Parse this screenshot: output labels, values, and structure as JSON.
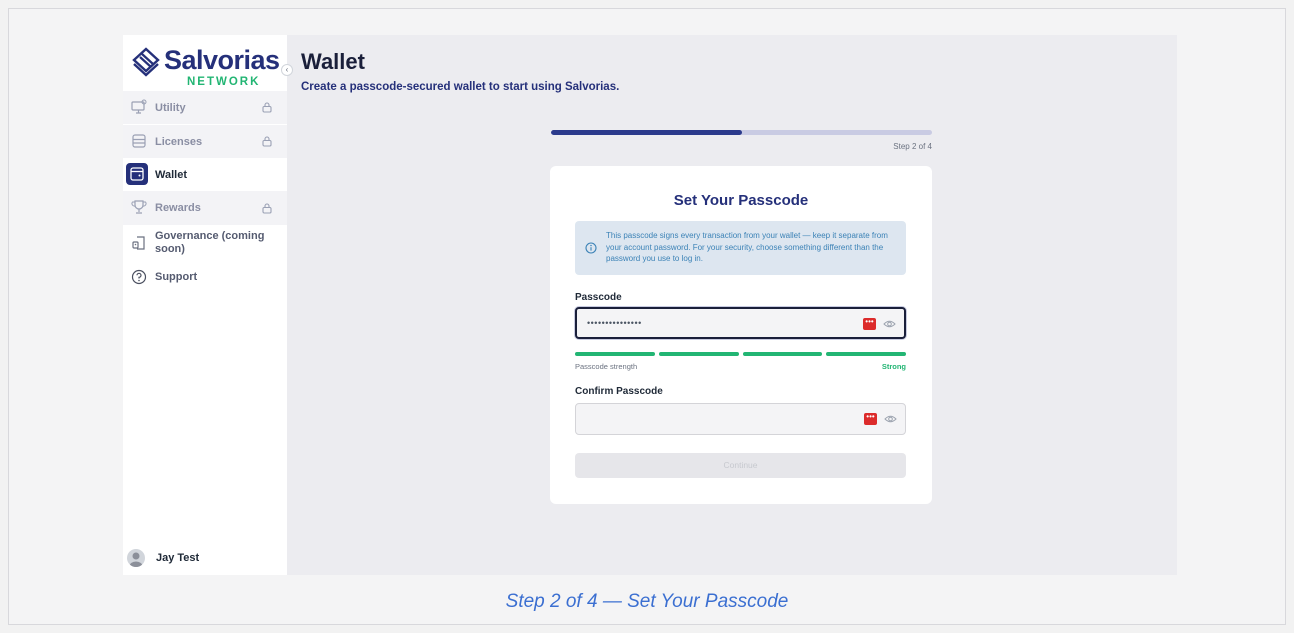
{
  "brand": {
    "name": "Salvorias",
    "sub": "NETWORK"
  },
  "sidebar": {
    "collapse_icon": "chevron-left",
    "items": [
      {
        "label": "Utility",
        "icon": "monitor-icon",
        "locked": true
      },
      {
        "label": "Licenses",
        "icon": "database-icon",
        "locked": true
      },
      {
        "label": "Wallet",
        "icon": "wallet-icon",
        "locked": false,
        "active": true
      },
      {
        "label": "Rewards",
        "icon": "trophy-icon",
        "locked": true
      },
      {
        "label": "Governance (coming soon)",
        "icon": "governance-icon",
        "locked": false
      },
      {
        "label": "Support",
        "icon": "help-icon",
        "locked": false
      }
    ],
    "user": {
      "name": "Jay Test"
    }
  },
  "main": {
    "title": "Wallet",
    "subtitle": "Create a passcode-secured wallet to start using Salvorias.",
    "progress": {
      "label": "Step 2 of 4",
      "fraction": 0.5
    },
    "card": {
      "title": "Set Your Passcode",
      "info": "This passcode signs every transaction from your wallet — keep it separate from your account password. For your security, choose something different than the password you use to log in.",
      "passcode": {
        "label": "Passcode",
        "value": "•••••••••••••••"
      },
      "strength": {
        "label": "Passcode strength",
        "value": "Strong",
        "filled_segments": 4,
        "total_segments": 4
      },
      "confirm": {
        "label": "Confirm Passcode",
        "value": ""
      },
      "continue_label": "Continue"
    }
  },
  "caption": "Step 2 of 4 — Set Your Passcode",
  "colors": {
    "brand_navy": "#25307a",
    "brand_green": "#22b573",
    "caption_blue": "#3b6fd1",
    "info_bg": "#dde6f0",
    "password_manager_red": "#dc2b2b"
  }
}
